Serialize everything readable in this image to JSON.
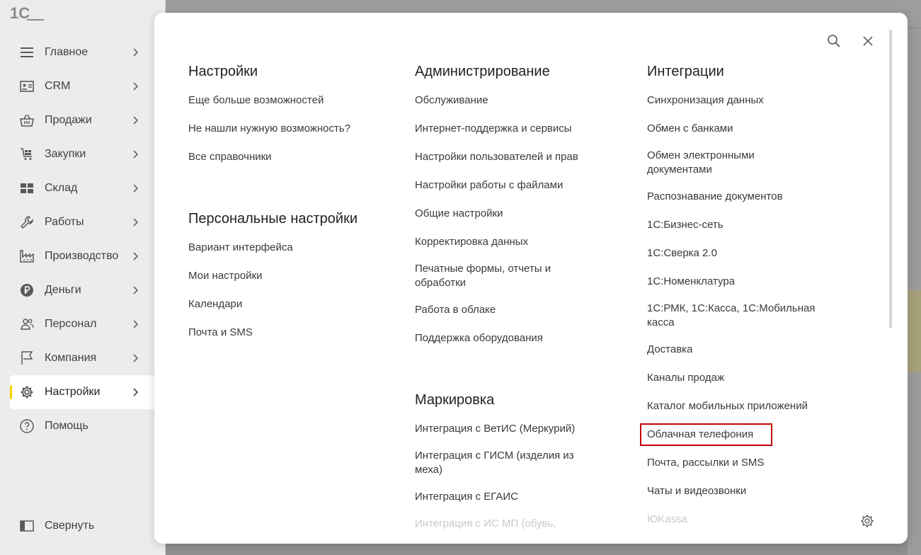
{
  "sidebar": {
    "logo": "1С",
    "items": [
      {
        "label": "Главное",
        "icon": "menu-icon"
      },
      {
        "label": "CRM",
        "icon": "contact-card-icon"
      },
      {
        "label": "Продажи",
        "icon": "basket-icon"
      },
      {
        "label": "Закупки",
        "icon": "cart-icon"
      },
      {
        "label": "Склад",
        "icon": "warehouse-icon"
      },
      {
        "label": "Работы",
        "icon": "wrench-icon"
      },
      {
        "label": "Производство",
        "icon": "factory-icon"
      },
      {
        "label": "Деньги",
        "icon": "ruble-icon"
      },
      {
        "label": "Персонал",
        "icon": "people-icon"
      },
      {
        "label": "Компания",
        "icon": "flag-icon"
      },
      {
        "label": "Настройки",
        "icon": "gear-icon",
        "active": true
      },
      {
        "label": "Помощь",
        "icon": "help-icon",
        "chevron": false
      }
    ],
    "collapse_label": "Свернуть",
    "active_accent": "#f6d200"
  },
  "panel": {
    "columns": [
      {
        "sections": [
          {
            "title": "Настройки",
            "links": [
              "Еще больше возможностей",
              "Не нашли нужную возможность?",
              "Все справочники"
            ]
          },
          {
            "title": "Персональные настройки",
            "links": [
              "Вариант интерфейса",
              "Мои настройки",
              "Календари",
              "Почта и SMS"
            ]
          }
        ]
      },
      {
        "sections": [
          {
            "title": "Администрирование",
            "links": [
              "Обслуживание",
              "Интернет-поддержка и сервисы",
              "Настройки пользователей и прав",
              "Настройки работы с файлами",
              "Общие настройки",
              "Корректировка данных",
              "Печатные формы, отчеты и обработки",
              "Работа в облаке",
              "Поддержка оборудования"
            ]
          },
          {
            "title": "Маркировка",
            "links": [
              "Интеграция с ВетИС (Меркурий)",
              "Интеграция с ГИСМ (изделия из меха)",
              "Интеграция с ЕГАИС",
              "Интеграция с ИС МП (обувь,"
            ]
          }
        ]
      },
      {
        "sections": [
          {
            "title": "Интеграции",
            "links": [
              "Синхронизация данных",
              "Обмен с банками",
              "Обмен электронными документами",
              "Распознавание документов",
              "1С:Бизнес-сеть",
              "1С:Сверка 2.0",
              "1С:Номенклатура",
              "1С:РМК, 1С:Касса, 1С:Мобильная касса",
              "Доставка",
              "Каналы продаж",
              "Каталог мобильных приложений",
              "Облачная телефония",
              "Почта, рассылки и SMS",
              "Чаты и видеозвонки",
              "ЮKassa"
            ]
          }
        ]
      }
    ],
    "highlighted_link": "Облачная телефония",
    "highlight_color": "#c00000"
  },
  "background": {
    "top_right_text": "··"
  }
}
